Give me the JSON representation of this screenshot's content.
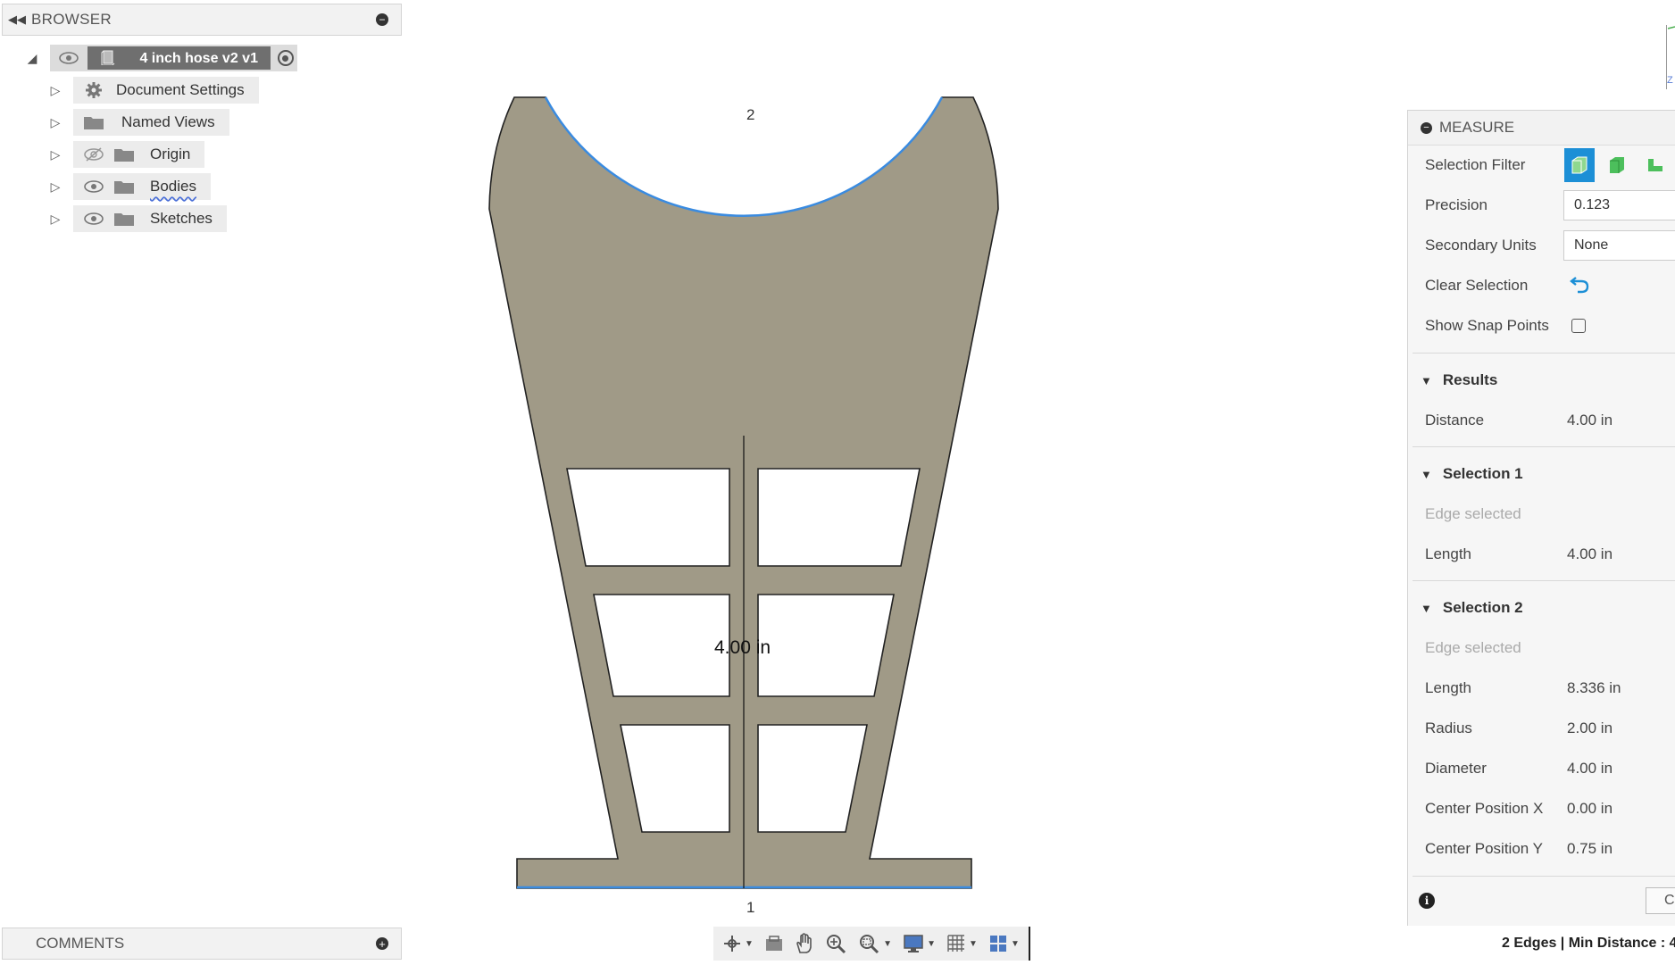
{
  "browser": {
    "title": "BROWSER",
    "root": "4 inch hose v2 v1",
    "items": [
      {
        "label": "Document Settings",
        "icon": "gear-icon"
      },
      {
        "label": "Named Views",
        "icon": "folder-icon"
      },
      {
        "label": "Origin",
        "icon": "folder-icon",
        "visibility": "hidden"
      },
      {
        "label": "Bodies",
        "icon": "folder-icon",
        "visibility": "visible"
      },
      {
        "label": "Sketches",
        "icon": "folder-icon",
        "visibility": "visible"
      }
    ]
  },
  "comments": {
    "title": "COMMENTS"
  },
  "canvas": {
    "point_1": "1",
    "point_2": "2",
    "dimension": "4.00 in"
  },
  "measure": {
    "title": "MEASURE",
    "selection_filter_label": "Selection Filter",
    "precision_label": "Precision",
    "precision_value": "0.123",
    "secondary_units_label": "Secondary Units",
    "secondary_units_value": "None",
    "clear_selection_label": "Clear Selection",
    "show_snap_points_label": "Show Snap Points",
    "results": {
      "title": "Results",
      "distance_label": "Distance",
      "distance_value": "4.00 in"
    },
    "selection1": {
      "title": "Selection 1",
      "status": "Edge selected",
      "length_label": "Length",
      "length_value": "4.00 in"
    },
    "selection2": {
      "title": "Selection 2",
      "status": "Edge selected",
      "length_label": "Length",
      "length_value": "8.336 in",
      "radius_label": "Radius",
      "radius_value": "2.00 in",
      "diameter_label": "Diameter",
      "diameter_value": "4.00 in",
      "cx_label": "Center Position X",
      "cx_value": "0.00 in",
      "cy_label": "Center Position Y",
      "cy_value": "0.75 in"
    },
    "close_label": "C"
  },
  "status": {
    "text": "2 Edges | Min Distance : 4"
  },
  "colors": {
    "part_fill": "#a09a87",
    "selection_blue": "#3a8be0",
    "filter_active": "#1c8fd6"
  }
}
